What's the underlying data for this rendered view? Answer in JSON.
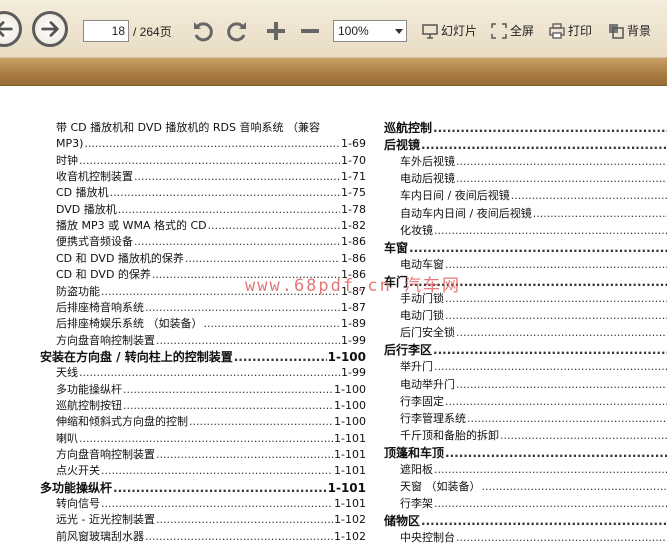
{
  "toolbar": {
    "page_current": "18",
    "page_total": "/ 264页",
    "zoom": "100%",
    "slideshow_label": "幻灯片",
    "fullscreen_label": "全屏",
    "print_label": "打印",
    "background_label": "背景"
  },
  "left": [
    {
      "text": "带 CD 播放机和 DVD 播放机的 RDS 音响系统 （兼容",
      "page": "",
      "level": 1
    },
    {
      "text": "MP3)",
      "page": "1-69",
      "level": 1
    },
    {
      "text": "时钟",
      "page": "1-70",
      "level": 1
    },
    {
      "text": "收音机控制装置",
      "page": "1-71",
      "level": 1
    },
    {
      "text": "CD 播放机",
      "page": "1-75",
      "level": 1
    },
    {
      "text": "DVD 播放机",
      "page": "1-78",
      "level": 1
    },
    {
      "text": "播放 MP3 或 WMA 格式的 CD",
      "page": "1-82",
      "level": 1
    },
    {
      "text": "便携式音频设备",
      "page": "1-86",
      "level": 1
    },
    {
      "text": "CD 和 DVD 播放机的保养",
      "page": "1-86",
      "level": 1
    },
    {
      "text": "CD 和 DVD 的保养",
      "page": "1-86",
      "level": 1
    },
    {
      "text": "防盗功能",
      "page": "1-87",
      "level": 1
    },
    {
      "text": "后排座椅音响系统",
      "page": "1-87",
      "level": 1
    },
    {
      "text": "后排座椅娱乐系统 （如装备）",
      "page": "1-89",
      "level": 1
    },
    {
      "text": "方向盘音响控制装置",
      "page": "1-99",
      "level": 1
    },
    {
      "text": "安装在方向盘 / 转向柱上的控制装置",
      "page": "1-100",
      "level": 0
    },
    {
      "text": "天线",
      "page": "1-99",
      "level": 1
    },
    {
      "text": "多功能操纵杆",
      "page": "1-100",
      "level": 1
    },
    {
      "text": "巡航控制按钮",
      "page": "1-100",
      "level": 1
    },
    {
      "text": "伸缩和倾斜式方向盘的控制",
      "page": "1-100",
      "level": 1
    },
    {
      "text": "喇叭",
      "page": "1-101",
      "level": 1
    },
    {
      "text": "方向盘音响控制装置",
      "page": "1-101",
      "level": 1
    },
    {
      "text": "点火开关",
      "page": "1-101",
      "level": 1
    },
    {
      "text": "多功能操纵杆",
      "page": "1-101",
      "level": 0
    },
    {
      "text": "转向信号",
      "page": "1-101",
      "level": 1
    },
    {
      "text": "远光 - 近光控制装置",
      "page": "1-102",
      "level": 1
    },
    {
      "text": "前风窗玻璃刮水器",
      "page": "1-102",
      "level": 1
    }
  ],
  "right": [
    {
      "text": "巡航控制",
      "level": 0
    },
    {
      "text": "后视镜",
      "level": 0
    },
    {
      "text": "车外后视镜",
      "level": 1
    },
    {
      "text": "电动后视镜",
      "level": 1
    },
    {
      "text": "车内日间 / 夜间后视镜",
      "level": 1
    },
    {
      "text": "自动车内日间 / 夜间后视镜",
      "level": 1
    },
    {
      "text": "化妆镜",
      "level": 1
    },
    {
      "text": "车窗",
      "level": 0
    },
    {
      "text": "电动车窗",
      "level": 1
    },
    {
      "text": "车门",
      "level": 0
    },
    {
      "text": "手动门锁",
      "level": 1
    },
    {
      "text": "电动门锁",
      "level": 1
    },
    {
      "text": "后门安全锁",
      "level": 1
    },
    {
      "text": "后行李区",
      "level": 0
    },
    {
      "text": "举升门",
      "level": 1
    },
    {
      "text": "电动举升门",
      "level": 1
    },
    {
      "text": "行李固定",
      "level": 1
    },
    {
      "text": "行李管理系统",
      "level": 1
    },
    {
      "text": "千斤顶和备胎的拆卸",
      "level": 1
    },
    {
      "text": "顶篷和车顶",
      "level": 0
    },
    {
      "text": "遮阳板",
      "level": 1
    },
    {
      "text": "天窗 （如装备）",
      "level": 1
    },
    {
      "text": "行李架",
      "level": 1
    },
    {
      "text": "储物区",
      "level": 0
    },
    {
      "text": "中央控制台",
      "level": 1
    }
  ],
  "watermark": "www.68pdf.cn 汽车网",
  "colors": {
    "toolbar_bg": "#efe5d0",
    "band": "#a77b3f",
    "watermark": "#e06060"
  }
}
